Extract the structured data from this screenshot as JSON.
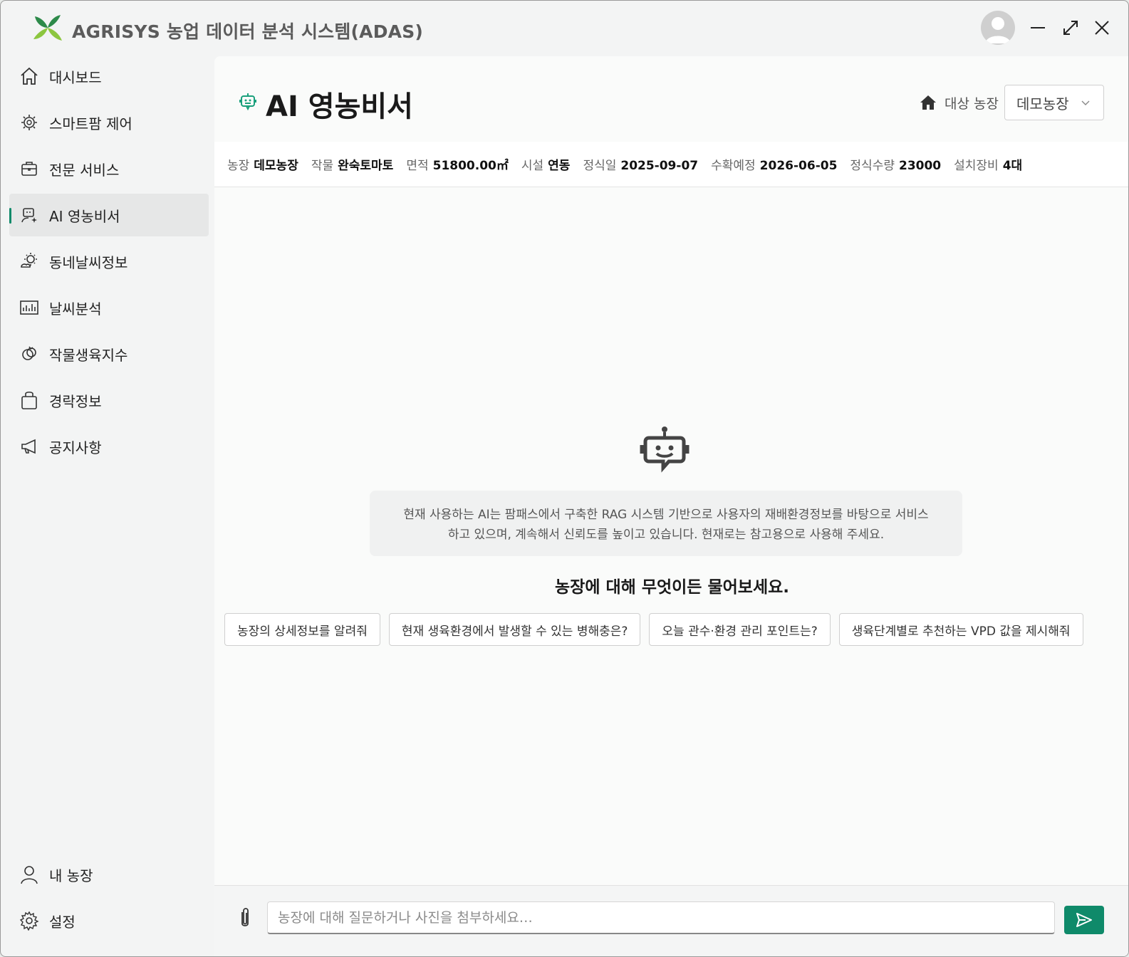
{
  "app": {
    "title": "AGRISYS 농업 데이터 분석 시스템(ADAS)",
    "accent_color": "#0f8a6a"
  },
  "window_controls": {
    "minimize_icon": "minimize-icon",
    "maximize_icon": "maximize-icon",
    "close_icon": "close-icon"
  },
  "sidebar": {
    "items": [
      {
        "label": "대시보드",
        "icon": "home-icon"
      },
      {
        "label": "스마트팜 제어",
        "icon": "chip-icon"
      },
      {
        "label": "전문 서비스",
        "icon": "briefcase-icon"
      },
      {
        "label": "AI 영농비서",
        "icon": "assistant-icon",
        "active": true
      },
      {
        "label": "동네날씨정보",
        "icon": "weather-icon"
      },
      {
        "label": "날씨분석",
        "icon": "chart-icon"
      },
      {
        "label": "작물생육지수",
        "icon": "crop-icon"
      },
      {
        "label": "경락정보",
        "icon": "shopping-bag-icon"
      },
      {
        "label": "공지사항",
        "icon": "megaphone-icon"
      }
    ],
    "bottom_items": [
      {
        "label": "내 농장",
        "icon": "person-icon"
      },
      {
        "label": "설정",
        "icon": "gear-icon"
      }
    ]
  },
  "page": {
    "title": "AI 영농비서",
    "farm_selector_label": "대상 농장",
    "farm_selected": "데모농장"
  },
  "info_bar": [
    {
      "key": "농장",
      "value": "데모농장"
    },
    {
      "key": "작물",
      "value": "완숙토마토"
    },
    {
      "key": "면적",
      "value": "51800.00㎡"
    },
    {
      "key": "시설",
      "value": "연동"
    },
    {
      "key": "정식일",
      "value": "2025-09-07"
    },
    {
      "key": "수확예정",
      "value": "2026-06-05"
    },
    {
      "key": "정식수량",
      "value": "23000"
    },
    {
      "key": "설치장비",
      "value": "4대"
    }
  ],
  "chat": {
    "notice_line1": "현재 사용하는 AI는 팜패스에서 구축한 RAG 시스템 기반으로 사용자의 재배환경정보를 바탕으로 서비스",
    "notice_line2": "하고 있으며, 계속해서 신뢰도를 높이고 있습니다. 현재로는 참고용으로 사용해 주세요.",
    "prompt_title": "농장에 대해 무엇이든 물어보세요.",
    "suggestions": [
      "농장의 상세정보를 알려줘",
      "현재 생육환경에서 발생할 수 있는 병해충은?",
      "오늘 관수·환경 관리 포인트는?",
      "생육단계별로 추천하는 VPD 값을 제시해줘"
    ],
    "input_placeholder": "농장에 대해 질문하거나 사진을 첨부하세요…"
  }
}
